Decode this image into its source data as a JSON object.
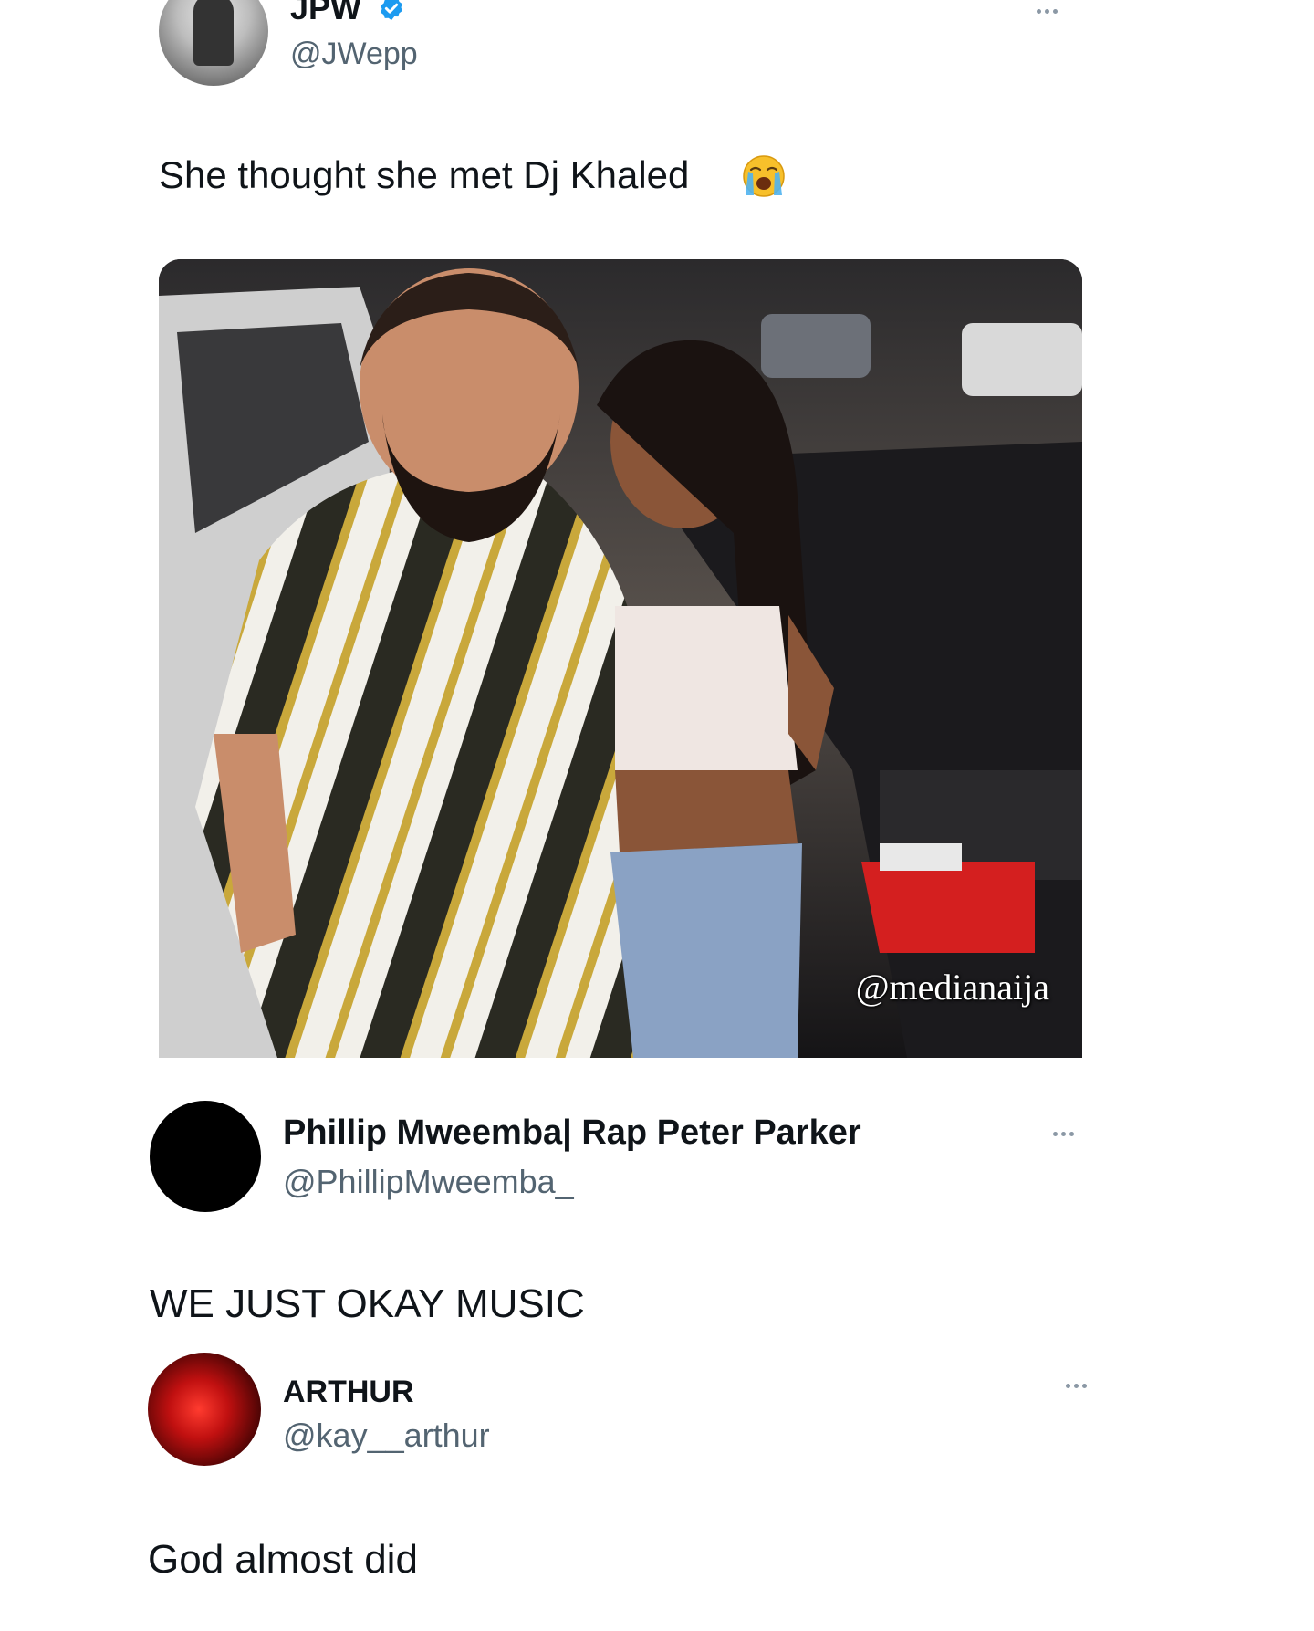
{
  "posts": [
    {
      "display_name": "JPW",
      "verified": true,
      "handle": "@JWepp",
      "text": "She thought she met Dj Khaled",
      "emoji": "loudly-crying-face",
      "media": {
        "watermark": "@medianaija"
      }
    },
    {
      "display_name": "Phillip Mweemba| Rap Peter Parker",
      "handle": "@PhillipMweemba_",
      "text": "WE JUST OKAY MUSIC"
    },
    {
      "display_name": "ARTHUR",
      "handle": "@kay__arthur",
      "text": "God almost did"
    }
  ],
  "colors": {
    "verified": "#1d9bf0",
    "handle": "#536471",
    "text": "#0f1419"
  }
}
